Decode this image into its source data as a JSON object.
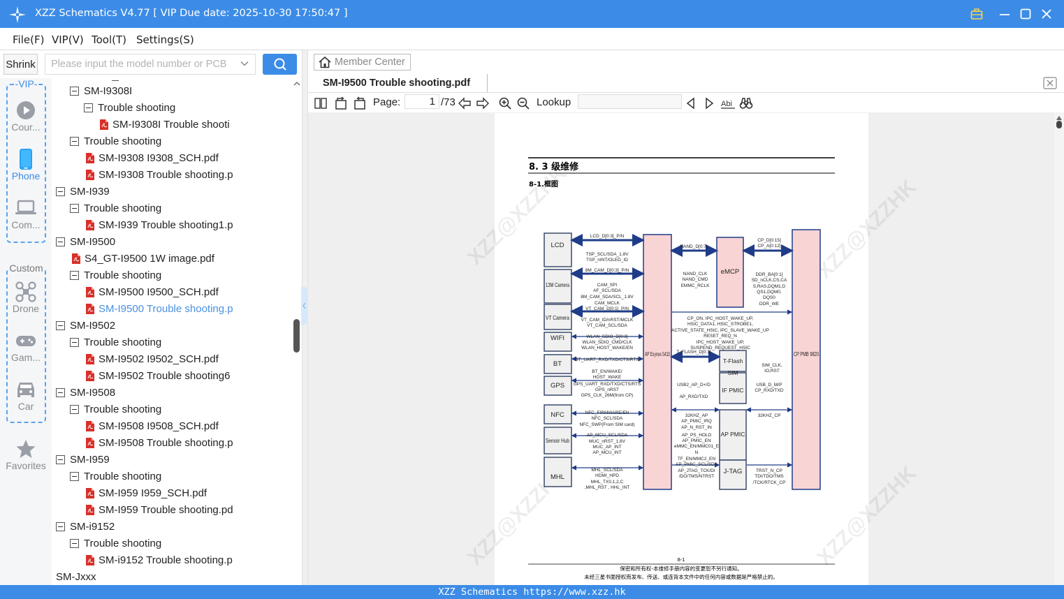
{
  "window": {
    "title": "XZZ Schematics V4.77 [ VIP Due date: 2025-10-30 17:50:47 ]"
  },
  "menu": {
    "file": "File(F)",
    "vip": "VIP(V)",
    "tool": "Tool(T)",
    "settings": "Settings(S)"
  },
  "toolbar_left": {
    "shrink_label": "Shrink",
    "search_placeholder": "Please input the model number or PCB"
  },
  "sidebar": {
    "vip_group_label": "-VIP-",
    "custom_group_label": "Custom",
    "items": [
      {
        "label": "Cour...",
        "icon": "play-circle-icon"
      },
      {
        "label": "Phone",
        "icon": "phone-icon"
      },
      {
        "label": "Com...",
        "icon": "laptop-icon"
      },
      {
        "label": "Drone",
        "icon": "drone-icon"
      },
      {
        "label": "Gam...",
        "icon": "gamepad-icon"
      },
      {
        "label": "Car",
        "icon": "car-icon"
      },
      {
        "label": "Favorites",
        "icon": "star-icon"
      }
    ]
  },
  "tree": [
    {
      "label": "SM-I9308I",
      "type": "folder",
      "level": 2
    },
    {
      "label": "Trouble shooting",
      "type": "folder",
      "level": 3
    },
    {
      "label": "SM-I9308I Trouble shooti",
      "type": "pdf",
      "level": 4
    },
    {
      "label": "Trouble shooting",
      "type": "folder",
      "level": 2
    },
    {
      "label": "SM-I9308 I9308_SCH.pdf",
      "type": "pdf",
      "level": 3
    },
    {
      "label": "SM-I9308 Trouble shooting.p",
      "type": "pdf",
      "level": 3
    },
    {
      "label": "SM-I939",
      "type": "folder",
      "level": 1
    },
    {
      "label": "Trouble shooting",
      "type": "folder",
      "level": 2
    },
    {
      "label": "SM-I939 Trouble shooting1.p",
      "type": "pdf",
      "level": 3
    },
    {
      "label": "SM-I9500",
      "type": "folder",
      "level": 1
    },
    {
      "label": "S4_GT-I9500 1W image.pdf",
      "type": "pdf",
      "level": 2
    },
    {
      "label": "Trouble shooting",
      "type": "folder",
      "level": 2
    },
    {
      "label": "SM-I9500 I9500_SCH.pdf",
      "type": "pdf",
      "level": 3
    },
    {
      "label": "SM-I9500 Trouble shooting.p",
      "type": "pdf",
      "level": 3,
      "selected": true
    },
    {
      "label": "SM-I9502",
      "type": "folder",
      "level": 1
    },
    {
      "label": "Trouble shooting",
      "type": "folder",
      "level": 2
    },
    {
      "label": "SM-I9502 I9502_SCH.pdf",
      "type": "pdf",
      "level": 3
    },
    {
      "label": "SM-I9502 Trouble shooting6",
      "type": "pdf",
      "level": 3
    },
    {
      "label": "SM-I9508",
      "type": "folder",
      "level": 1
    },
    {
      "label": "Trouble shooting",
      "type": "folder",
      "level": 2
    },
    {
      "label": "SM-I9508 I9508_SCH.pdf",
      "type": "pdf",
      "level": 3
    },
    {
      "label": "SM-I9508 Trouble shooting.p",
      "type": "pdf",
      "level": 3
    },
    {
      "label": "SM-I959",
      "type": "folder",
      "level": 1
    },
    {
      "label": "Trouble shooting",
      "type": "folder",
      "level": 2
    },
    {
      "label": "SM-I959  I959_SCH.pdf",
      "type": "pdf",
      "level": 3
    },
    {
      "label": "SM-I959 Trouble shooting.pd",
      "type": "pdf",
      "level": 3
    },
    {
      "label": "SM-i9152",
      "type": "folder",
      "level": 1
    },
    {
      "label": "Trouble shooting",
      "type": "folder",
      "level": 2
    },
    {
      "label": "SM-i9152 Trouble shooting.p",
      "type": "pdf",
      "level": 3
    },
    {
      "label": "SM-Jxxx",
      "type": "folder",
      "level": 0
    }
  ],
  "viewer": {
    "member_center_label": "Member Center",
    "tab_title": "SM-I9500 Trouble shooting.pdf",
    "page_label": "Page:",
    "page_current": "1",
    "page_total": "/73",
    "lookup_label": "Lookup",
    "lookup_value": ""
  },
  "pdf": {
    "heading": "8. 3 级维修",
    "subheading": "8-1.框图",
    "watermark": "XZZ@XZZHK",
    "page_number": "8-1",
    "footer_line1": "保密和所有权-本维修手册内容的变更恕不另行通知。",
    "footer_line2": "未经三星书面授权而发布、传送、或连背本文件中的任何内容或数据是严格禁止的。",
    "blocks": {
      "lcd": "LCD",
      "cam13": "13M Camera",
      "vt": "VT Camera",
      "wifi": "WIFI",
      "bt": "BT",
      "gps": "GPS",
      "nfc": "NFC",
      "sensor": "Sensor Hub",
      "mhl": "MHL",
      "ap": "AP Exynos 5410",
      "emcp": "eMCP",
      "tflash": "T-Flash",
      "sim": "SIM",
      "ifpmic": "IF PMIC",
      "appmic": "AP PMIC",
      "jtag": "J-TAG",
      "cp": "CP PMB 9820"
    },
    "signals": {
      "s1": "LCD_D[0:3]_P/N",
      "s2": "TSP_SCL/SDA_1.8V",
      "s3": "TSP_nINT/OLED_ID",
      "s4": "8M_CAM_D[0:3]_P/N",
      "s5": "CAM_SPI",
      "s6": "AF_SCL/SDA",
      "s7": "8M_CAM_SDA/SCL_1.8V",
      "s8": "CAM_MCLK",
      "s9": "VT_CAM_D[0:1]_P/N",
      "s10": "VT_CAM_ID/nRST/MCLK",
      "s11": "VT_CAM_SCL/SDA",
      "s12": "WLAN_SDIO_D[0:3]",
      "s13": "WLAN_SDIO_CMD/CLK",
      "s14": "WLAN_HOST_WAKE/EN",
      "s15": "BT_UART_RXD/TXD/CTS/RTS",
      "s16": "BT_EN/WAKE/",
      "s17": "HOST_WAKE",
      "s18": "GPS_UART_RXD/TXD/CTS/RTS",
      "s19": "GPS_nRST",
      "s20": "GPS_CLK_26M(from CP)",
      "s21": "NFC_FIRMWARE/EN",
      "s22": "NFC_SCL/SDA",
      "s23": "NFC_SWP(From SIM card)",
      "s24": "AP_MCU_SCL/SDA",
      "s25": "MUC_nRST_1.8V",
      "s26": "MUC_AP_INT",
      "s27": "AP_MCU_INT",
      "s28": "MHL_SCL/SDA",
      "s29": "HDMI_HPD",
      "s30": "MHL_TX0,1,2,C",
      "s31": ",MHL_RST , HHL_INT",
      "s32": "NAND_D[0:7]",
      "s33": "NAND_CLK",
      "s34": "NAND_CMD",
      "s35": "EMMC_RCLK",
      "s36": "CP_D[0:15]",
      "s37": "CP_A[0:12]",
      "s38": "DDR_BA[0:1]",
      "s39": "SD_nCLK,CS,CA",
      "s40": "S,RAS,DQM1,D",
      "s41": "QS1,DQM0,",
      "s42": "DQS0",
      "s43": "DDR_WE",
      "s44": "CP_ON, IPC_HOST_WAKE_UP,",
      "s45": "HSIC_DATA1, HSIC_STROBE1,",
      "s46": "ACTIVE_STATE_HSIC, IPC_SLAVE_WAKE_UP",
      "s47": "RESET_REQ_N",
      "s48": "IPC_HOST_WAKE_UP,",
      "s49": "SUSPEND_REQUEST_HSIC",
      "s50": "T_FLASH_D[0:3]",
      "s51": "SIM_CLK,",
      "s52": "IO,RST",
      "s53": "USB2_AP_D+/D",
      "s54": "AP_RXD/TXD",
      "s55": "USB_D_M/P",
      "s56": "CP_RXD/TXD",
      "s57": "32KHZ_AP",
      "s58": "AP_PMIC_IRQ",
      "s59": "AP_N_RST_IN",
      "s60": "32KHZ_CP",
      "s61": "AP_PS_HOLD",
      "s62": "AP_PMIC_EN",
      "s63": "eMMC_EN/MMC01_E",
      "s64": "N",
      "s65": "TF_EN/MMC2_EN",
      "s66": "AP_PMIC_SCL/SDA",
      "s67": "AP_JTAG_TCK/DI",
      "s68": "/DO/TMS/NTRST",
      "s69": "TRST_N_CP",
      "s70": "TDI/TDO/TMS",
      "s71": "/TCK/RTCK_CP"
    }
  },
  "statusbar": {
    "text": "XZZ Schematics https://www.xzz.hk"
  },
  "colors": {
    "accent": "#3C8CE7",
    "block_fill": "#F9D4D4",
    "block_stroke": "#1F3C88",
    "pdf_icon": "#D9302A"
  }
}
